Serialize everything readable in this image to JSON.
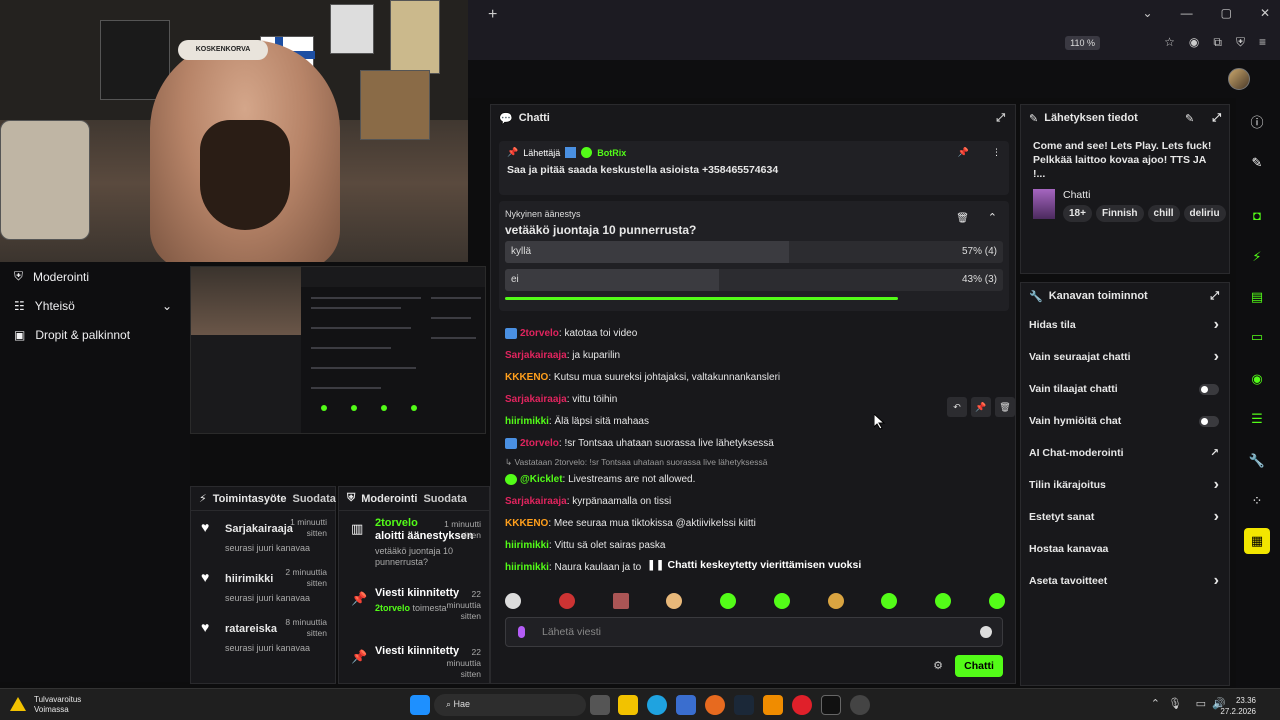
{
  "browser": {
    "zoom": "110 %",
    "new_tab": "+"
  },
  "webcam": {
    "headband": "KOSKENKORVA"
  },
  "left_nav": {
    "items": [
      {
        "label": "Moderointi"
      },
      {
        "label": "Yhteisö"
      },
      {
        "label": "Dropit & palkinnot"
      }
    ]
  },
  "activity": {
    "title": "Toimintasyöte",
    "sub": "Suodata",
    "items": [
      {
        "name": "Sarjakairaaja",
        "time": "1 minuutti sitten",
        "note": "seurasi juuri kanavaa"
      },
      {
        "name": "hiirimikki",
        "time": "2 minuuttia sitten",
        "note": "seurasi juuri kanavaa"
      },
      {
        "name": "ratareiska",
        "time": "8 minuuttia sitten",
        "note": "seurasi juuri kanavaa"
      }
    ]
  },
  "moderation": {
    "title": "Moderointi",
    "sub": "Suodata",
    "items": [
      {
        "user": "2torvelo",
        "action": "aloitti äänestyksen",
        "detail": "vetääkö juontaja 10 punnerrusta?",
        "time": "1 minuutti sitten"
      },
      {
        "user": "",
        "action": "Viesti kiinnitetty",
        "detail_user": "2torvelo",
        "detail": "toimesta",
        "time": "22 minuuttia sitten"
      },
      {
        "user": "",
        "action": "Viesti kiinnitetty",
        "time": "22 minuuttia sitten"
      }
    ]
  },
  "chat": {
    "title": "Chatti",
    "pinned": {
      "label": "Lähettäjä",
      "sender": "BotRix",
      "message": "Saa ja pitää saada keskustella asioista +358465574634"
    },
    "poll": {
      "label": "Nykyinen äänestys",
      "question": "vetääkö juontaja 10 punnerrusta?",
      "options": [
        {
          "text": "kyllä",
          "pct": "57% (4)",
          "fraction": 0.57
        },
        {
          "text": "ei",
          "pct": "43% (3)",
          "fraction": 0.43
        }
      ],
      "progress": 0.79
    },
    "messages": [
      {
        "user": "2torvelo",
        "color": "#e0245e",
        "badge": "blue",
        "text": "katotaa toi video"
      },
      {
        "user": "Sarjakairaaja",
        "color": "#e0245e",
        "text": "ja kuparilin"
      },
      {
        "user": "KKKENO",
        "color": "#ff9f1c",
        "text": "Kutsu mua suureksi johtajaksi, valtakunnankansleri"
      },
      {
        "user": "Sarjakairaaja",
        "color": "#e0245e",
        "text": "vittu töihin"
      },
      {
        "user": "hiirimikki",
        "color": "#53fc18",
        "text": "Älä läpsi sitä mahaas"
      },
      {
        "user": "2torvelo",
        "color": "#e0245e",
        "badge": "blue",
        "text": "!sr Tontsaa uhataan suorassa live lähetyksessä"
      }
    ],
    "reply_note": "Vastataan 2torvelo: !sr Tontsaa uhataan suorassa live lähetyksessä",
    "messages2": [
      {
        "user": "@Kicklet",
        "color": "#53fc18",
        "badge": "green",
        "text": "Livestreams are not allowed."
      },
      {
        "user": "Sarjakairaaja",
        "color": "#e0245e",
        "text": "kyrpänaamalla on tissi"
      },
      {
        "user": "KKKENO",
        "color": "#ff9f1c",
        "text": "Mee seuraa mua tiktokissa @aktiivikelssi kiitti"
      },
      {
        "user": "hiirimikki",
        "color": "#53fc18",
        "text": "Vittu sä olet sairas paska"
      },
      {
        "user": "hiirimikki",
        "color": "#53fc18",
        "text": "Naura kaulaan ja tolj"
      }
    ],
    "paused": "Chatti keskeytetty vierittämisen vuoksi",
    "placeholder": "Lähetä viesti",
    "send": "Chatti"
  },
  "info": {
    "title": "Lähetyksen tiedot",
    "stream_title": "Come and see! Lets Play. Lets fuck! Pelkkää laittoo kovaa ajoo! TTS JA !...",
    "category": "Chatti",
    "tags": [
      "18+",
      "Finnish",
      "chill",
      "deliriu"
    ]
  },
  "actions": {
    "title": "Kanavan toiminnot",
    "rows": [
      {
        "label": "Hidas tila",
        "kind": "arrow"
      },
      {
        "label": "Vain seuraajat chatti",
        "kind": "arrow"
      },
      {
        "label": "Vain tilaajat chatti",
        "kind": "toggle"
      },
      {
        "label": "Vain hymiöitä chat",
        "kind": "toggle"
      },
      {
        "label": "AI Chat-moderointi",
        "kind": "ext"
      },
      {
        "label": "Tilin ikärajoitus",
        "kind": "arrow"
      },
      {
        "label": "Estetyt sanat",
        "kind": "arrow"
      },
      {
        "label": "Hostaa kanavaa",
        "kind": "none"
      },
      {
        "label": "Aseta tavoitteet",
        "kind": "arrow"
      }
    ]
  },
  "taskbar": {
    "warn_title": "Tulvavaroitus",
    "warn_sub": "Voimassa",
    "search": "Hae",
    "time": "23.36",
    "date": "27.2.2026"
  }
}
